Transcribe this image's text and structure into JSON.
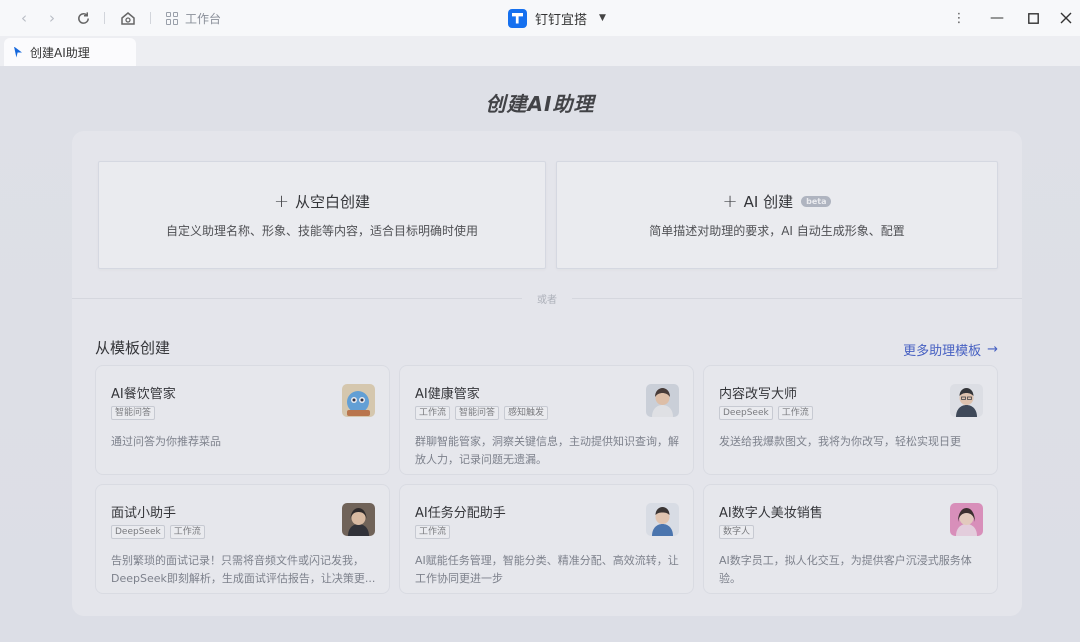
{
  "titlebar": {
    "workbench_label": "工作台",
    "app_name": "钉钉宜搭"
  },
  "tab": {
    "label": "创建AI助理"
  },
  "page": {
    "title": "创建AI助理",
    "blank_card": {
      "title": "从空白创建",
      "desc": "自定义助理名称、形象、技能等内容，适合目标明确时使用"
    },
    "ai_card": {
      "title": "AI 创建",
      "badge": "beta",
      "desc": "简单描述对助理的要求，AI 自动生成形象、配置"
    },
    "divider_text": "或者",
    "templates_title": "从模板创建",
    "more_templates": "更多助理模板",
    "templates": [
      {
        "name": "AI餐饮管家",
        "tags": [
          "智能问答"
        ],
        "desc": "通过问答为你推荐菜品"
      },
      {
        "name": "AI健康管家",
        "tags": [
          "工作流",
          "智能问答",
          "感知触发"
        ],
        "desc": "群聊智能管家，洞察关键信息，主动提供知识查询，解放人力，记录问题无遗漏。"
      },
      {
        "name": "内容改写大师",
        "tags": [
          "DeepSeek",
          "工作流"
        ],
        "desc": "发送给我爆款图文，我将为你改写，轻松实现日更"
      },
      {
        "name": "面试小助手",
        "tags": [
          "DeepSeek",
          "工作流"
        ],
        "desc": "告别繁琐的面试记录！只需将音频文件或闪记发我，DeepSeek即刻解析，生成面试评估报告，让决策更..."
      },
      {
        "name": "AI任务分配助手",
        "tags": [
          "工作流"
        ],
        "desc": "AI赋能任务管理，智能分类、精准分配、高效流转，让工作协同更进一步"
      },
      {
        "name": "AI数字人美妆销售",
        "tags": [
          "数字人"
        ],
        "desc": "AI数字员工，拟人化交互，为提供客户沉浸式服务体验。"
      }
    ]
  }
}
